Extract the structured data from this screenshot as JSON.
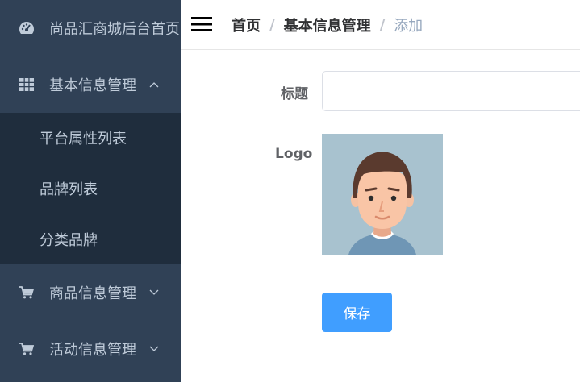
{
  "sidebar": {
    "items": [
      {
        "label": "尚品汇商城后台首页",
        "icon": "dashboard-icon"
      },
      {
        "label": "基本信息管理",
        "icon": "grid-icon",
        "expanded": true
      },
      {
        "label": "商品信息管理",
        "icon": "cart-icon",
        "expanded": false
      },
      {
        "label": "活动信息管理",
        "icon": "cart-icon",
        "expanded": false
      }
    ],
    "submenu": [
      "平台属性列表",
      "品牌列表",
      "分类品牌"
    ]
  },
  "header": {
    "icon": "hamburger-icon",
    "breadcrumb": [
      "首页",
      "基本信息管理",
      "添加"
    ],
    "separator": "/"
  },
  "form": {
    "title_label": "标题",
    "title_value": "",
    "logo_label": "Logo",
    "logo_image": "avatar-image",
    "save_label": "保存"
  },
  "colors": {
    "sidebar_bg": "#304156",
    "submenu_bg": "#1f2d3d",
    "menu_text": "#bfcbd9",
    "primary": "#409eff"
  }
}
